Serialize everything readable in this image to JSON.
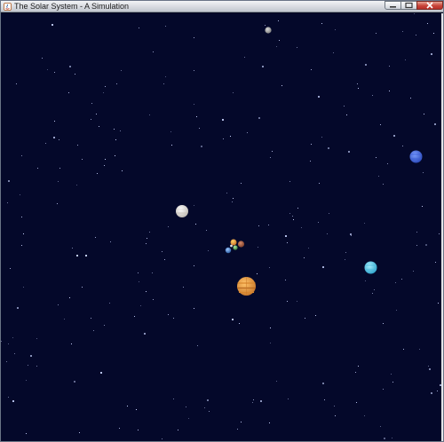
{
  "window": {
    "title": "The Solar System - A Simulation",
    "controls": {
      "minimize_icon": "minimize-icon",
      "maximize_icon": "maximize-icon",
      "close_icon": "close-icon"
    }
  },
  "scene": {
    "background_color": "#04082a",
    "star_color": "#c8d4ff",
    "bodies": [
      {
        "name": "gray-moon-top",
        "color": "#b9b9b9",
        "accent": "#7d7d7d"
      },
      {
        "name": "white-planet",
        "color": "#f2eeea",
        "accent": "#bdb7b0"
      },
      {
        "name": "inner-cluster-orange",
        "color": "#f0b13a",
        "accent": "#c86a20"
      },
      {
        "name": "inner-cluster-brown",
        "color": "#b86a4a",
        "accent": "#7a3a26"
      },
      {
        "name": "inner-cluster-green",
        "color": "#6fbf6a",
        "accent": "#3a7a3a"
      },
      {
        "name": "inner-cluster-blue",
        "color": "#4f8fd8",
        "accent": "#2a5aa0"
      },
      {
        "name": "large-orange-planet",
        "color": "#f2a440",
        "accent": "#c8772a"
      },
      {
        "name": "cyan-planet",
        "color": "#5fd2f2",
        "accent": "#2aa0c8"
      },
      {
        "name": "blue-planet-right",
        "color": "#3f6ff0",
        "accent": "#2a48b8"
      }
    ]
  }
}
